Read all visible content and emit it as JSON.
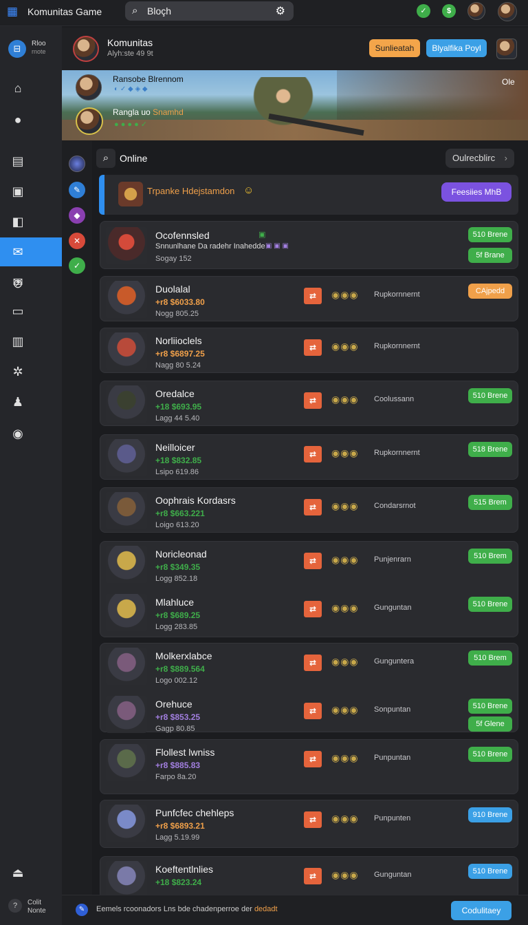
{
  "app": {
    "title": "Komunitas Game",
    "search_placeholder": "Bloçh"
  },
  "sidebar": {
    "top_label_1": "Rloo",
    "top_label_2": "rnote",
    "bottom_label_1": "Colit",
    "bottom_label_2": "Nonte"
  },
  "group": {
    "name": "Komunitas",
    "meta": "Alyh:ste 49 9t",
    "btn_primary": "Sunlieatah",
    "btn_secondary": "Blyalfika Poyl"
  },
  "banner": {
    "line1": "Ransobe Blrennom",
    "line2": "Rangla uo",
    "line2_accent": "Snamhd",
    "corner": "Ole",
    "colors": {
      "accent": "#f0a04a"
    }
  },
  "filter": {
    "label": "Online",
    "sort": "Oulrecblirc"
  },
  "promo": {
    "text": "Trpanke Hdejstamdon",
    "button": "Feesiies MhB"
  },
  "featured": {
    "name": "Ocofennsled",
    "desc": "Snnunlhane Da radehr Inahedde",
    "sub": "Sogay 152",
    "btn1": "510 Brene",
    "btn2": "5f Brane"
  },
  "items": [
    {
      "name": "Duolalal",
      "price": "+r8 $6033.80",
      "sub": "Nogg 805.25",
      "label": "Rupkornnernt",
      "btn": "CAjpedd",
      "btn_color": "orange",
      "price_color": "orange"
    },
    {
      "name": "Norliioclels",
      "price": "+r8 $6897.25",
      "sub": "Nagg 80 5.24",
      "label": "Rupkornnernt",
      "btn": "",
      "btn_color": "",
      "price_color": "orange"
    },
    {
      "name": "Oredalce",
      "price": "+18 $693.95",
      "sub": "Lagg 44 5.40",
      "label": "Coolussann",
      "btn": "510 Brene",
      "btn_color": "green",
      "price_color": "green"
    },
    {
      "name": "Neilloicer",
      "price": "+18 $832.85",
      "sub": "Lsipo 619.86",
      "label": "Rupkornnernt",
      "btn": "518 Brene",
      "btn_color": "green",
      "price_color": "green"
    },
    {
      "name": "Oophrais Kordasrs",
      "price": "+r8 $663.221",
      "sub": "Loigo 613.20",
      "label": "Condarsrnot",
      "btn": "515 Brem",
      "btn_color": "green",
      "price_color": "green"
    },
    {
      "name": "Noricleonad",
      "price": "+r8 $349.35",
      "sub": "Logg 852.18",
      "label": "Punjenrarn",
      "btn": "510 Brem",
      "btn_color": "green",
      "price_color": "green"
    },
    {
      "name": "Mlahluce",
      "price": "+r8 $689.25",
      "sub": "Logg 283.85",
      "label": "Gunguntan",
      "btn": "510 Brene",
      "btn_color": "green",
      "price_color": "green"
    },
    {
      "name": "Molkerxlabce",
      "price": "+r8 $889.564",
      "sub": "Logo 002.12",
      "label": "Gunguntera",
      "btn": "510 Brem",
      "btn_color": "green",
      "price_color": "green"
    },
    {
      "name": "Orehuce",
      "price": "+r8 $853.25",
      "sub": "Gagp 80.85",
      "label": "Sonpuntan",
      "btn": "510 Brene",
      "btn2": "5f Glene",
      "btn_color": "green",
      "price_color": "purple"
    },
    {
      "name": "Flollest lwniss",
      "price": "+r8 $885.83",
      "sub": "Farpo 8a.20",
      "label": "Punpuntan",
      "btn": "510 Brene",
      "btn_color": "green",
      "price_color": "purple"
    },
    {
      "name": "Punfcfec chehleps",
      "price": "+r8 $6893.21",
      "sub": "Lagg 5.19.99",
      "label": "Punpunten",
      "btn": "910 Brene",
      "btn_color": "blue",
      "price_color": "orange"
    },
    {
      "name": "Koeftentlnlies",
      "price": "+18 $823.24",
      "sub": "",
      "label": "Gunguntan",
      "btn": "510 Brene",
      "btn_color": "blue",
      "price_color": "green"
    }
  ],
  "footer": {
    "text": "Eemels rcoonadors Lns bde chadenperroe der",
    "accent": "dedadt",
    "button": "Codulitaey"
  }
}
